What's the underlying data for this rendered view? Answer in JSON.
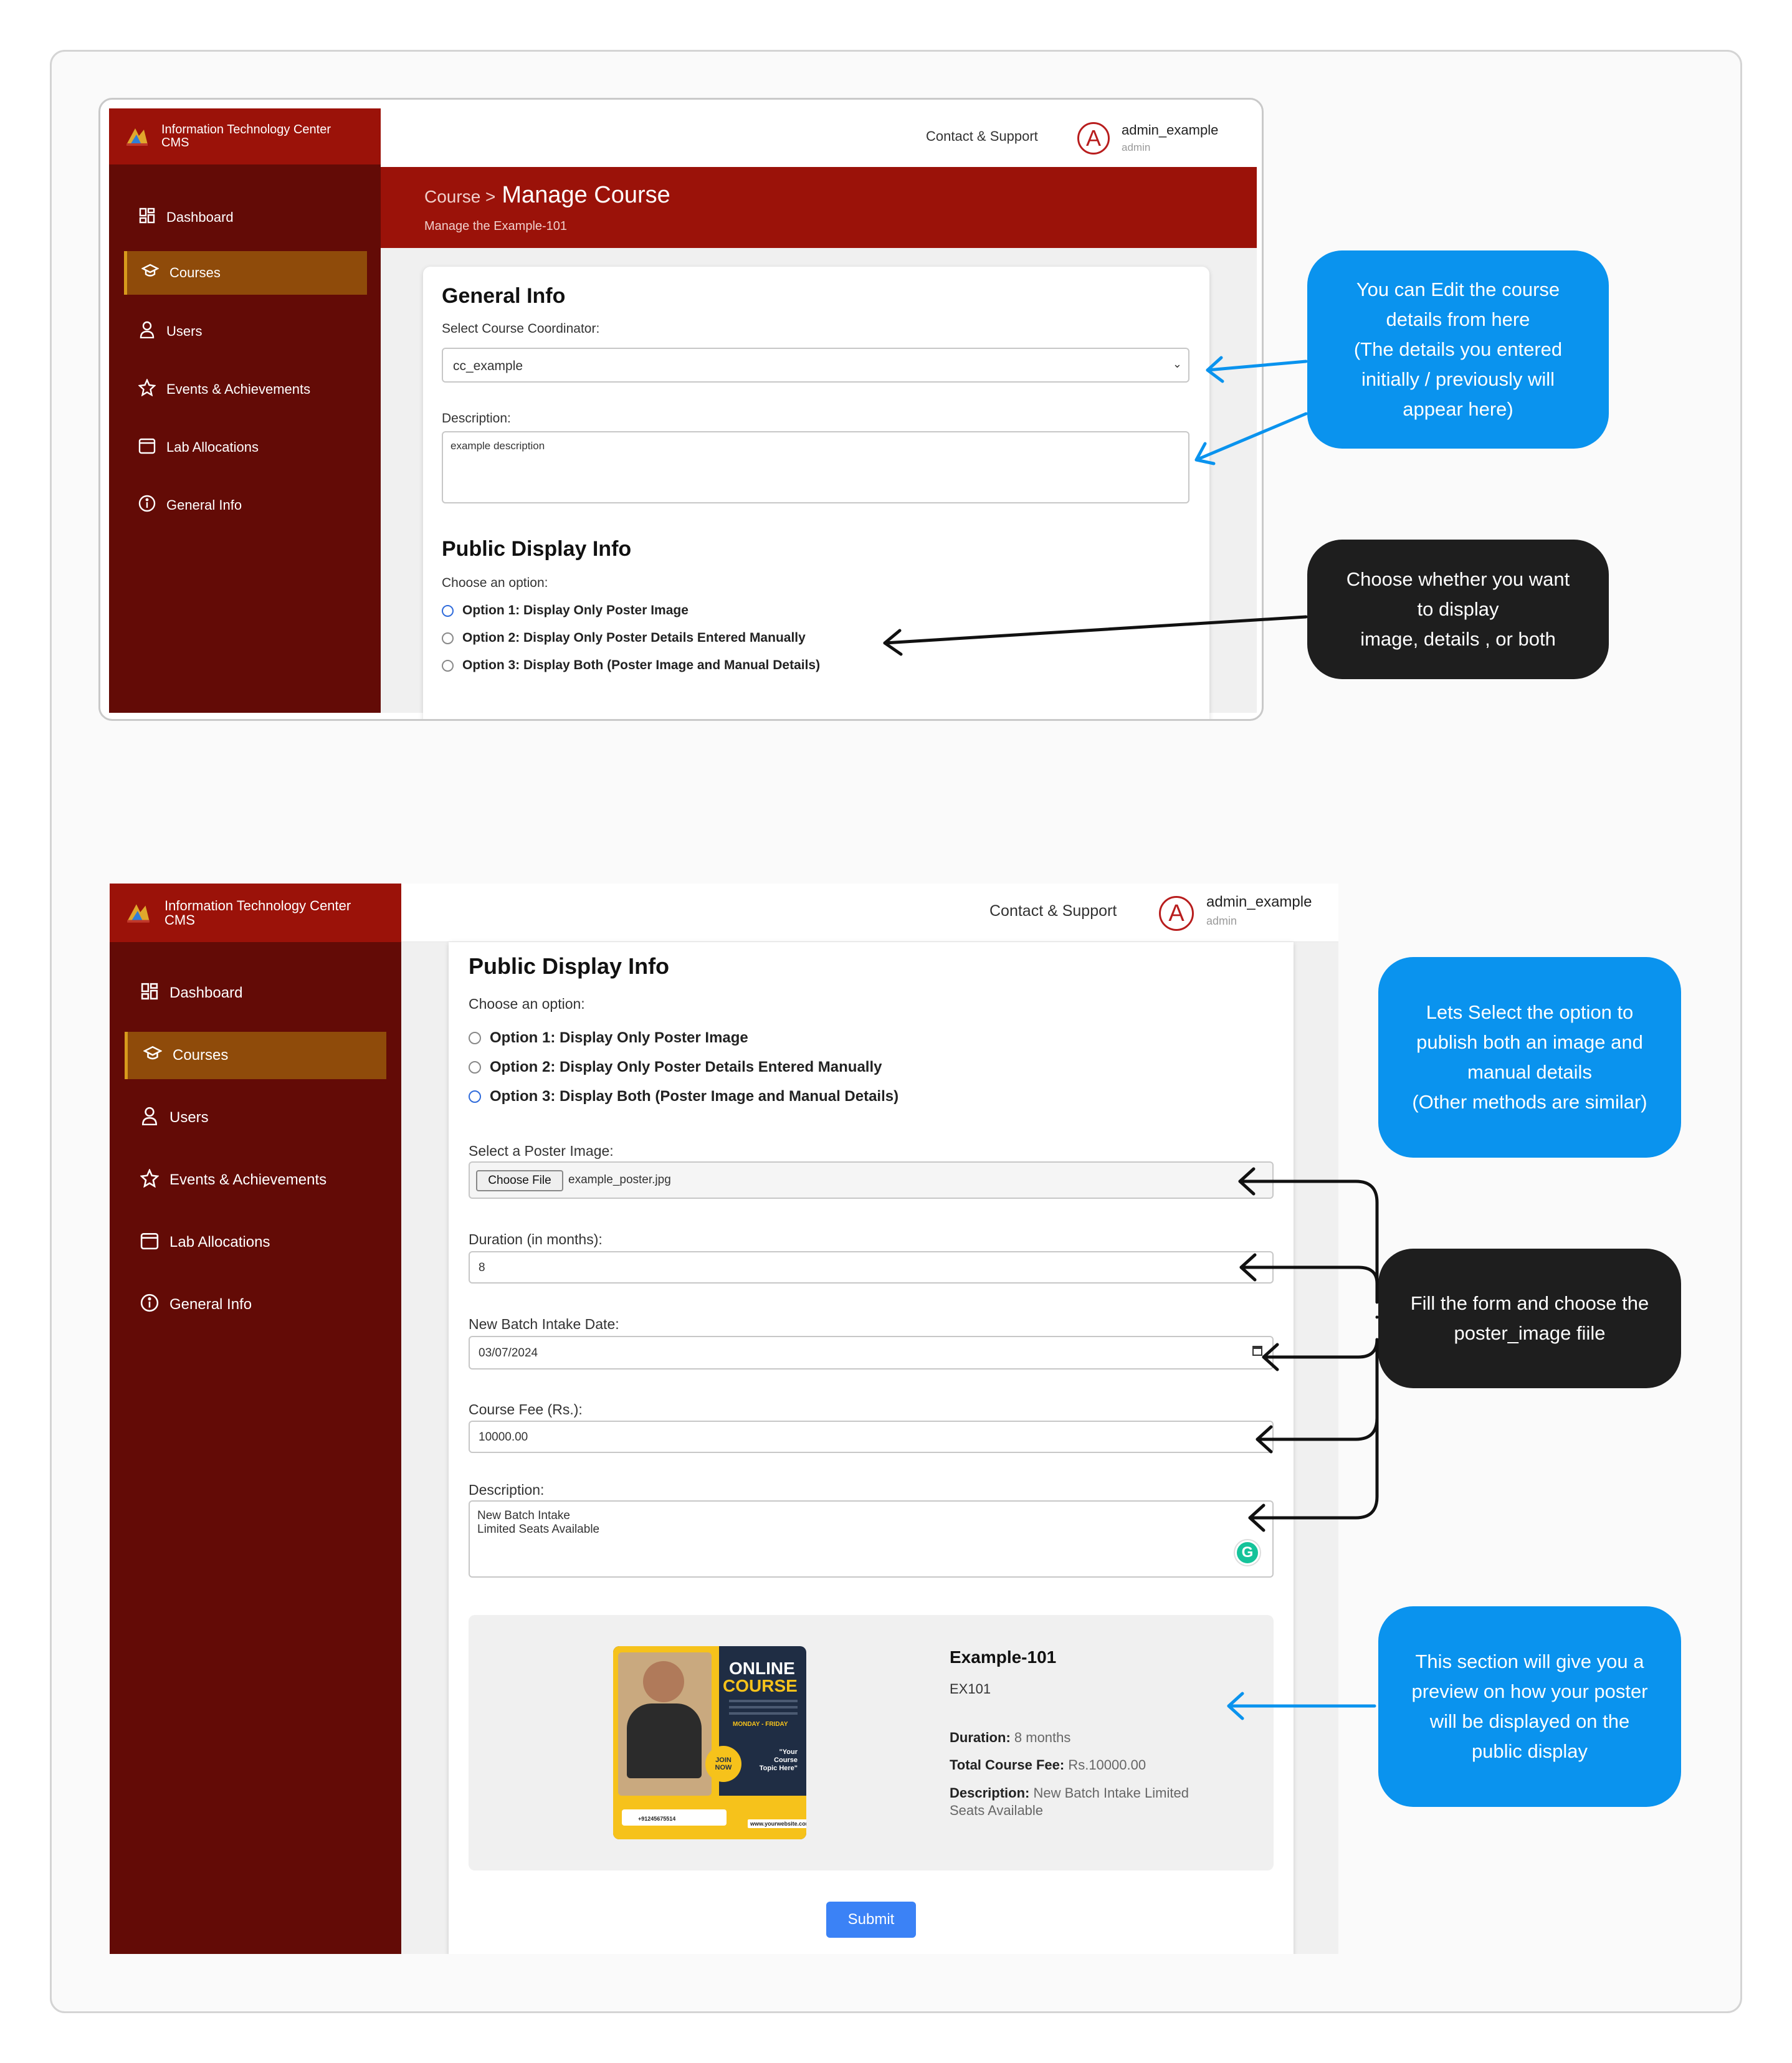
{
  "app": {
    "brand_line1": "Information Technology Center",
    "brand_line2": "CMS",
    "contact": "Contact & Support",
    "user_name": "admin_example",
    "user_role": "admin",
    "avatar_letter": "A"
  },
  "nav": [
    {
      "label": "Dashboard",
      "icon": "grid-icon"
    },
    {
      "label": "Courses",
      "icon": "graduation-cap-icon",
      "active": true
    },
    {
      "label": "Users",
      "icon": "user-icon"
    },
    {
      "label": "Events & Achievements",
      "icon": "star-icon"
    },
    {
      "label": "Lab Allocations",
      "icon": "calendar-icon"
    },
    {
      "label": "General Info",
      "icon": "info-icon"
    }
  ],
  "screen1": {
    "breadcrumb_prefix": "Course >",
    "title": "Manage Course",
    "subtitle": "Manage the Example-101",
    "general_info": "General Info",
    "coordinator_label": "Select Course Coordinator:",
    "coordinator_value": "cc_example",
    "description_label": "Description:",
    "description_value": "example description",
    "public_display": "Public Display Info",
    "choose_option": "Choose an option:",
    "options": [
      "Option 1: Display Only Poster Image",
      "Option 2: Display Only Poster Details Entered Manually",
      "Option 3: Display Both (Poster Image and Manual Details)"
    ],
    "selected_option": 0
  },
  "screen2": {
    "public_display": "Public Display Info",
    "choose_option": "Choose an option:",
    "options": [
      "Option 1: Display Only Poster Image",
      "Option 2: Display Only Poster Details Entered Manually",
      "Option 3: Display Both (Poster Image and Manual Details)"
    ],
    "selected_option": 2,
    "poster_label": "Select a Poster Image:",
    "choose_file": "Choose File",
    "file_name": "example_poster.jpg",
    "duration_label": "Duration (in months):",
    "duration_value": "8",
    "intake_label": "New Batch Intake Date:",
    "intake_value": "03/07/2024",
    "fee_label": "Course Fee (Rs.):",
    "fee_value": "10000.00",
    "desc_label": "Description:",
    "desc_line1": "New Batch Intake",
    "desc_line2": "Limited Seats Available",
    "preview": {
      "name": "Example-101",
      "code": "EX101",
      "duration_key": "Duration:",
      "duration_val": "8 months",
      "fee_key": "Total Course Fee:",
      "fee_val": "Rs.10000.00",
      "desc_key": "Description:",
      "desc_val_line1": "New Batch Intake Limited",
      "desc_val_line2": "Seats Available",
      "poster_title1": "ONLINE",
      "poster_title2": "COURSE",
      "poster_days": "MONDAY - FRIDAY",
      "poster_join1": "JOIN",
      "poster_join2": "NOW",
      "poster_topic": "\"Your Course Topic Here\"",
      "poster_site": "www.yourwebsite.com",
      "poster_phone": "+91245675514"
    },
    "submit": "Submit"
  },
  "callouts": {
    "edit": [
      "You can Edit the course",
      "details from here",
      "(The details you entered",
      "initially / previously will",
      "appear here)"
    ],
    "choose": [
      "Choose whether you want",
      "to display",
      "image, details , or both"
    ],
    "select_option": [
      "Lets Select the option to",
      "publish both an image and",
      "manual details",
      "(Other methods are similar)"
    ],
    "fill_form": [
      "Fill the form and choose the",
      "poster_image fiile"
    ],
    "preview": [
      "This section will give you a",
      "preview on how your poster",
      "will be displayed on the",
      "public display"
    ]
  },
  "colors": {
    "sidebar": "#630b06",
    "brand_red": "#9b1209",
    "active_nav": "#8f4b0a",
    "callout_blue": "#0a93ee",
    "callout_dark": "#1e1e1e",
    "submit_blue": "#3b82f6"
  }
}
